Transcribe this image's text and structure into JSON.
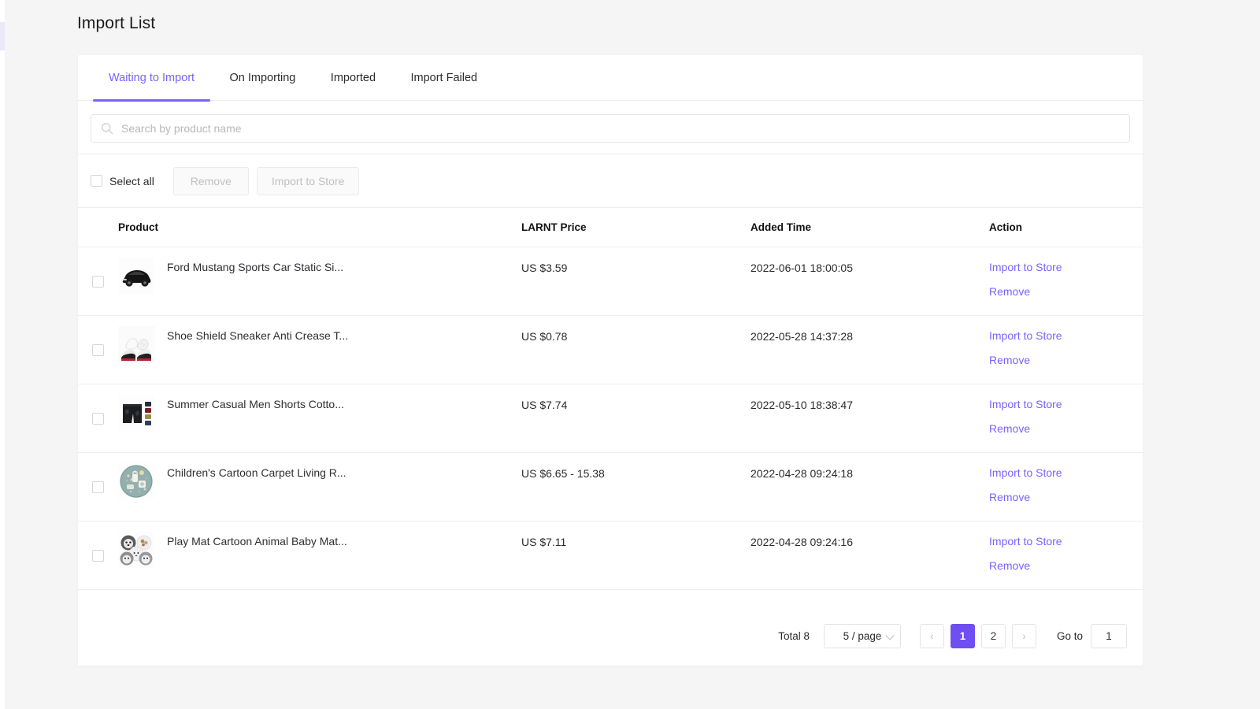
{
  "page": {
    "title": "Import List"
  },
  "tabs": [
    {
      "label": "Waiting to Import",
      "active": true
    },
    {
      "label": "On Importing",
      "active": false
    },
    {
      "label": "Imported",
      "active": false
    },
    {
      "label": "Import Failed",
      "active": false
    }
  ],
  "search": {
    "placeholder": "Search by product name",
    "value": "",
    "icon": "search-icon"
  },
  "toolbar": {
    "select_all_label": "Select all",
    "remove_label": "Remove",
    "import_label": "Import to Store"
  },
  "table": {
    "headers": [
      "Product",
      "LARNT Price",
      "Added Time",
      "Action"
    ],
    "rows": [
      {
        "name": "Ford Mustang Sports Car Static Si...",
        "price": "US $3.59",
        "time": "2022-06-01 18:00:05",
        "import_label": "Import to Store",
        "remove_label": "Remove",
        "thumb": "sports-car-thumbnail"
      },
      {
        "name": "Shoe Shield Sneaker Anti Crease T...",
        "price": "US $0.78",
        "time": "2022-05-28 14:37:28",
        "import_label": "Import to Store",
        "remove_label": "Remove",
        "thumb": "sneaker-shield-thumbnail"
      },
      {
        "name": "Summer Casual Men Shorts Cotto...",
        "price": "US $7.74",
        "time": "2022-05-10 18:38:47",
        "import_label": "Import to Store",
        "remove_label": "Remove",
        "thumb": "men-shorts-thumbnail"
      },
      {
        "name": "Children's Cartoon Carpet Living R...",
        "price": "US $6.65 - 15.38",
        "time": "2022-04-28 09:24:18",
        "import_label": "Import to Store",
        "remove_label": "Remove",
        "thumb": "round-carpet-thumbnail"
      },
      {
        "name": "Play Mat Cartoon Animal Baby Mat...",
        "price": "US $7.11",
        "time": "2022-04-28 09:24:16",
        "import_label": "Import to Store",
        "remove_label": "Remove",
        "thumb": "animal-play-mat-thumbnail"
      }
    ]
  },
  "pagination": {
    "total_label": "Total 8",
    "page_size_label": "5 / page",
    "prev_label": "‹",
    "next_label": "›",
    "pages": [
      "1",
      "2"
    ],
    "current_page": "1",
    "goto_label": "Go to",
    "goto_value": "1"
  },
  "colors": {
    "accent": "#7b61ff",
    "active_page": "#6f4ef2",
    "page_bg": "#f5f5f5",
    "card_bg": "#ffffff",
    "border": "#eeeeee"
  }
}
